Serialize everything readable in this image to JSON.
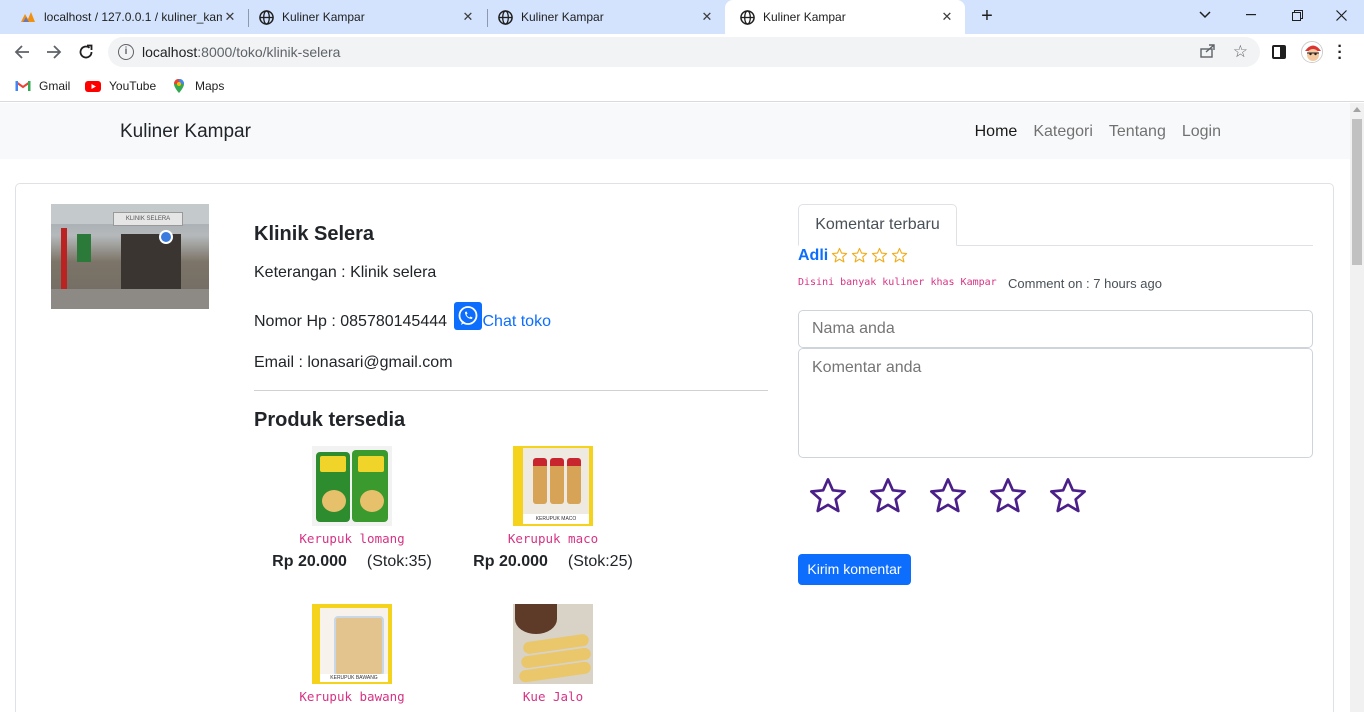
{
  "browser": {
    "tabs": [
      {
        "title": "localhost / 127.0.0.1 / kuliner_kampar",
        "icon": "phpmyadmin-icon"
      },
      {
        "title": "Kuliner Kampar",
        "icon": "globe-icon"
      },
      {
        "title": "Kuliner Kampar",
        "icon": "globe-icon"
      },
      {
        "title": "Kuliner Kampar",
        "icon": "globe-icon"
      }
    ],
    "url_host": "localhost",
    "url_path": ":8000/toko/klinik-selera",
    "bookmarks": [
      {
        "label": "Gmail",
        "icon": "gmail-icon"
      },
      {
        "label": "YouTube",
        "icon": "youtube-icon"
      },
      {
        "label": "Maps",
        "icon": "maps-icon"
      }
    ]
  },
  "navbar": {
    "brand": "Kuliner Kampar",
    "links": [
      "Home",
      "Kategori",
      "Tentang",
      "Login"
    ],
    "active": "Home"
  },
  "shop": {
    "photo_sign": "KLINIK SELERA",
    "name": "Klinik Selera",
    "description": "Keterangan : Klinik selera",
    "phone": "Nomor Hp : 085780145444",
    "chat_label": "Chat toko",
    "email": "Email : lonasari@gmail.com"
  },
  "products_title": "Produk tersedia",
  "products": [
    {
      "name": "Kerupuk lomang",
      "price": "Rp 20.000",
      "stock": "(Stok:35)",
      "thumb_text": ""
    },
    {
      "name": "Kerupuk maco",
      "price": "Rp 20.000",
      "stock": "(Stok:25)",
      "thumb_text": "KERUPUK MACO"
    },
    {
      "name": "Kerupuk bawang",
      "price": "",
      "stock": "",
      "thumb_text": "KERUPUK BAWANG"
    },
    {
      "name": "Kue Jalo",
      "price": "",
      "stock": "",
      "thumb_text": ""
    }
  ],
  "comments": {
    "tab_label": "Komentar terbaru",
    "latest": {
      "author": "Adli",
      "stars": 0,
      "stars_max": 5,
      "text": "Disini banyak kuliner khas Kampar",
      "time": "Comment on : 7 hours ago"
    },
    "name_placeholder": "Nama anda",
    "comment_placeholder": "Komentar anda",
    "rating_max": 5,
    "submit_label": "Kirim komentar"
  },
  "colors": {
    "link": "#0d6efd",
    "code_pink": "#d63384",
    "star_outline_small": "#f0ad1e",
    "star_outline_rating": "#4b1f8a"
  }
}
